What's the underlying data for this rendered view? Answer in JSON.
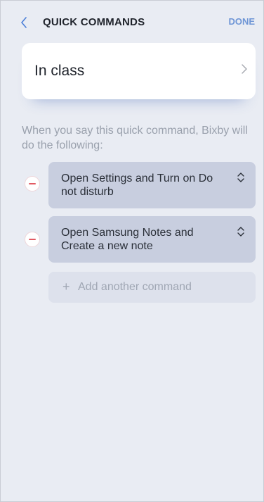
{
  "header": {
    "back_icon": "chevron-left-icon",
    "title": "QUICK COMMANDS",
    "done_label": "DONE"
  },
  "command": {
    "phrase": "In class",
    "chevron_icon": "chevron-right-icon"
  },
  "description": "When you say this quick command, Bixby will do the following:",
  "actions": [
    {
      "text": "Open Settings and Turn on Do not disturb"
    },
    {
      "text": "Open Samsung Notes and Create a new note"
    }
  ],
  "add_command": {
    "plus_glyph": "+",
    "label": "Add another command"
  },
  "colors": {
    "background": "#e9ecf3",
    "accent": "#4b7fd8",
    "remove_red": "#e25a63",
    "action_box": "#c8cedf"
  }
}
